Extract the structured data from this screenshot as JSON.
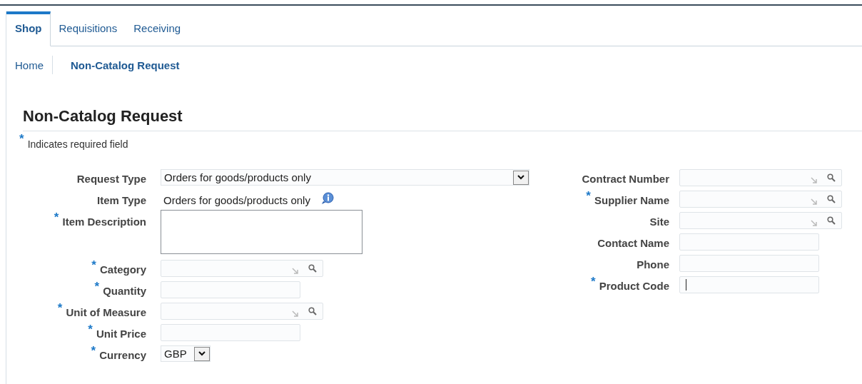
{
  "tabs": [
    {
      "label": "Shop",
      "selected": true
    },
    {
      "label": "Requisitions",
      "selected": false
    },
    {
      "label": "Receiving",
      "selected": false
    }
  ],
  "breadcrumbs": [
    {
      "label": "Home",
      "current": false
    },
    {
      "label": "Non-Catalog Request",
      "current": true
    }
  ],
  "page_title": "Non-Catalog Request",
  "required_mark": "*",
  "required_legend": "Indicates required field",
  "left_fields": [
    {
      "label": "Request Type",
      "kind": "select",
      "value": "Orders for goods/products only",
      "required": false
    },
    {
      "label": "Item Type",
      "kind": "readonly",
      "value": "Orders for goods/products only",
      "required": false
    },
    {
      "label": "Item Description",
      "kind": "textarea",
      "required": true
    },
    {
      "label": "Category",
      "kind": "lov",
      "required": true
    },
    {
      "label": "Quantity",
      "kind": "text",
      "required": true
    },
    {
      "label": "Unit of Measure",
      "kind": "lov",
      "required": true
    },
    {
      "label": "Unit Price",
      "kind": "text",
      "required": true
    },
    {
      "label": "Currency",
      "kind": "smallselect",
      "value": "GBP",
      "required": true
    }
  ],
  "right_fields": [
    {
      "label": "Contract Number",
      "kind": "lov",
      "required": false
    },
    {
      "label": "Supplier Name",
      "kind": "lov",
      "required": true
    },
    {
      "label": "Site",
      "kind": "lov",
      "required": false
    },
    {
      "label": "Contact Name",
      "kind": "text",
      "required": false
    },
    {
      "label": "Phone",
      "kind": "text",
      "required": false
    },
    {
      "label": "Product Code",
      "kind": "text",
      "required": true,
      "focused": true
    }
  ]
}
